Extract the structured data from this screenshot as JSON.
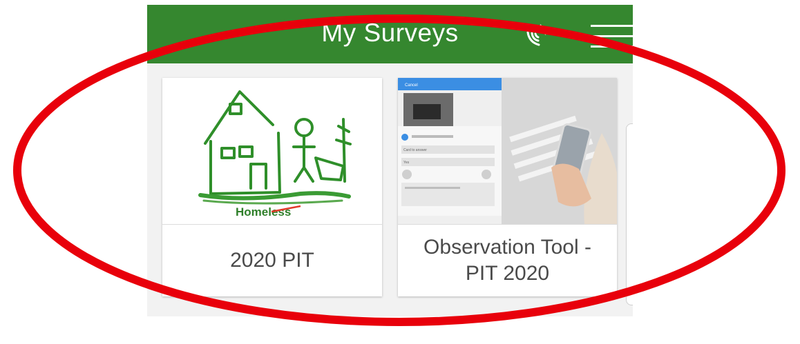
{
  "header": {
    "title": "My Surveys",
    "background": "#35872f",
    "status_icon": "satellite-signal-icon",
    "menu_icon": "hamburger-menu-icon"
  },
  "surveys": [
    {
      "title": "2020 PIT",
      "thumbnail": "house-drawing-thumbnail",
      "thumbnail_caption": "Homeless"
    },
    {
      "title": "Observation Tool - PIT 2020",
      "thumbnail": "phone-street-photo-thumbnail",
      "screen_text": "Cancel",
      "screen_fields": [
        "Card to answer",
        "Yes"
      ]
    }
  ],
  "annotation": {
    "shape": "ellipse",
    "color": "#e8000b"
  }
}
